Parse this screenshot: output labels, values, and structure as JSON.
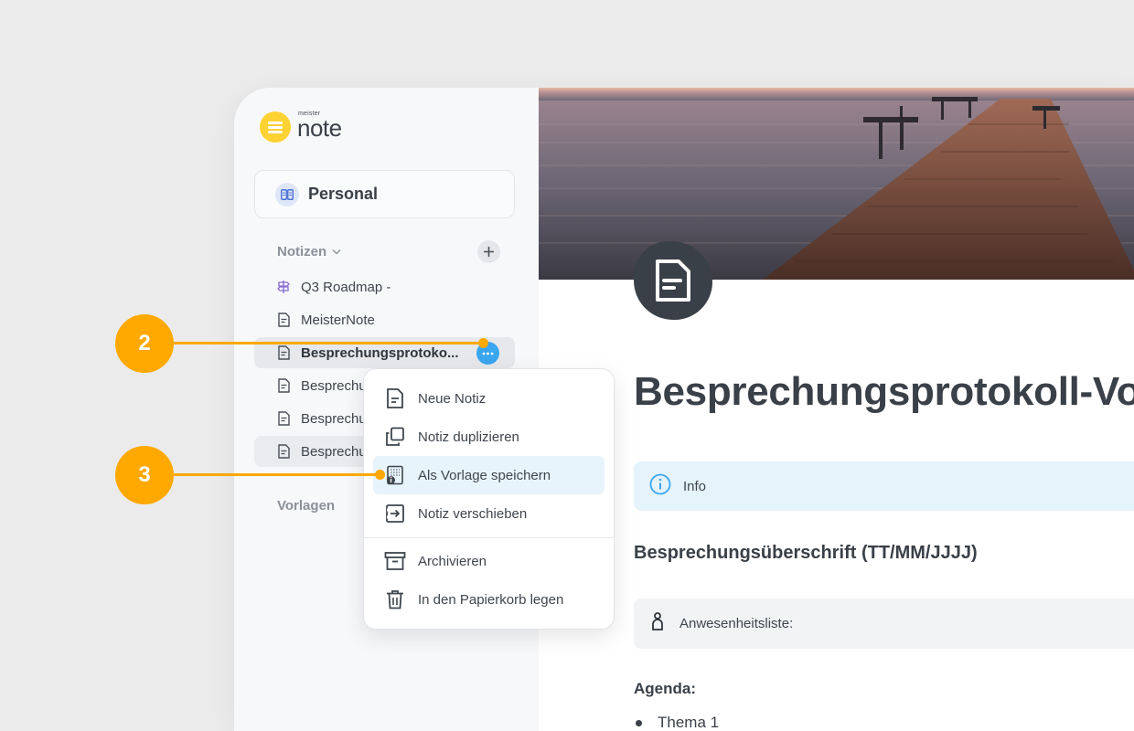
{
  "logo": {
    "small": "meister",
    "big": "note"
  },
  "workspace": {
    "label": "Personal"
  },
  "sidebar": {
    "notes_heading": "Notizen",
    "templates_heading": "Vorlagen",
    "items": [
      {
        "label": "Q3 Roadmap -",
        "icon": "signpost-icon"
      },
      {
        "label": "MeisterNote",
        "icon": "note-icon"
      },
      {
        "label": "Besprechungsprotoko...",
        "icon": "note-icon"
      },
      {
        "label": "Besprechu",
        "icon": "note-icon"
      },
      {
        "label": "Besprechu",
        "icon": "note-icon"
      },
      {
        "label": "Besprechu",
        "icon": "note-icon"
      }
    ]
  },
  "menu": {
    "items": [
      {
        "label": "Neue Notiz",
        "icon": "new-note-icon"
      },
      {
        "label": "Notiz duplizieren",
        "icon": "duplicate-icon"
      },
      {
        "label": "Als Vorlage speichern",
        "icon": "save-template-icon"
      },
      {
        "label": "Notiz verschieben",
        "icon": "move-icon"
      },
      {
        "label": "Archivieren",
        "icon": "archive-icon"
      },
      {
        "label": "In den Papierkorb legen",
        "icon": "trash-icon"
      }
    ]
  },
  "document": {
    "title": "Besprechungsprotokoll-Vorl",
    "info_label": "Info",
    "meeting_heading": "Besprechungsüberschrift (TT/MM/JJJJ)",
    "attendance_label": "Anwesenheitsliste:",
    "agenda_heading": "Agenda:",
    "agenda_items": [
      "Thema 1"
    ]
  },
  "callouts": {
    "step2": "2",
    "step3": "3"
  },
  "colors": {
    "accent": "#3aa6f0",
    "callout": "#ffa800",
    "logo": "#ffd233",
    "info_bg": "#e5f3fb"
  }
}
